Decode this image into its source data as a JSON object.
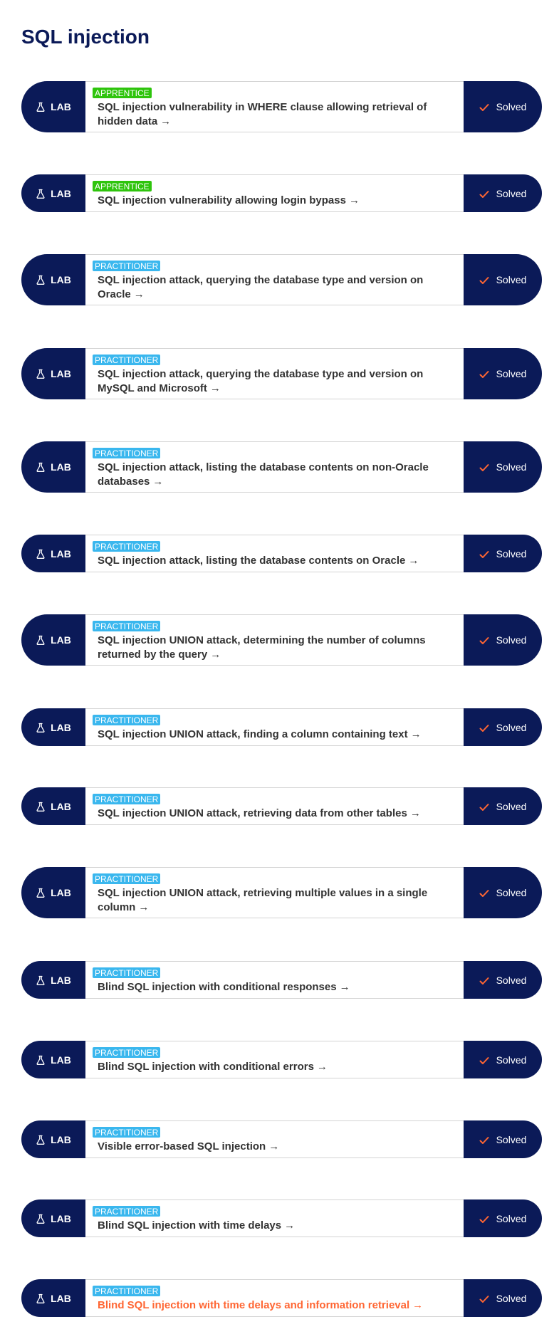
{
  "page": {
    "title": "SQL injection"
  },
  "colors": {
    "navy": "#0b1a58",
    "apprentice": "#2ec40c",
    "practitioner": "#3ab7ee",
    "accent_orange": "#ff6633",
    "text": "#333333"
  },
  "labs": [
    {
      "tag": "LAB",
      "level": "APPRENTICE",
      "title": "SQL injection vulnerability in WHERE clause allowing retrieval of hidden data",
      "status": "Solved",
      "arrow": "arrow-right-icon",
      "highlight": false
    },
    {
      "tag": "LAB",
      "level": "APPRENTICE",
      "title": "SQL injection vulnerability allowing login bypass",
      "status": "Solved",
      "arrow": "arrow-right-icon",
      "highlight": false
    },
    {
      "tag": "LAB",
      "level": "PRACTITIONER",
      "title": "SQL injection attack, querying the database type and version on Oracle",
      "status": "Solved",
      "arrow": "arrow-right-icon",
      "highlight": false
    },
    {
      "tag": "LAB",
      "level": "PRACTITIONER",
      "title": "SQL injection attack, querying the database type and version on MySQL and Microsoft",
      "status": "Solved",
      "arrow": "arrow-right-icon",
      "highlight": false
    },
    {
      "tag": "LAB",
      "level": "PRACTITIONER",
      "title": "SQL injection attack, listing the database contents on non-Oracle databases",
      "status": "Solved",
      "arrow": "arrow-right-icon",
      "highlight": false
    },
    {
      "tag": "LAB",
      "level": "PRACTITIONER",
      "title": "SQL injection attack, listing the database contents on Oracle",
      "status": "Solved",
      "arrow": "arrow-right-icon",
      "highlight": false
    },
    {
      "tag": "LAB",
      "level": "PRACTITIONER",
      "title": "SQL injection UNION attack, determining the number of columns returned by the query",
      "status": "Solved",
      "arrow": "arrow-right-icon",
      "highlight": false
    },
    {
      "tag": "LAB",
      "level": "PRACTITIONER",
      "title": "SQL injection UNION attack, finding a column containing text",
      "status": "Solved",
      "arrow": "arrow-right-icon",
      "highlight": false
    },
    {
      "tag": "LAB",
      "level": "PRACTITIONER",
      "title": "SQL injection UNION attack, retrieving data from other tables",
      "status": "Solved",
      "arrow": "arrow-right-icon",
      "highlight": false
    },
    {
      "tag": "LAB",
      "level": "PRACTITIONER",
      "title": "SQL injection UNION attack, retrieving multiple values in a single column",
      "status": "Solved",
      "arrow": "arrow-right-icon",
      "highlight": false
    },
    {
      "tag": "LAB",
      "level": "PRACTITIONER",
      "title": "Blind SQL injection with conditional responses",
      "status": "Solved",
      "arrow": "arrow-right-icon",
      "highlight": false
    },
    {
      "tag": "LAB",
      "level": "PRACTITIONER",
      "title": "Blind SQL injection with conditional errors",
      "status": "Solved",
      "arrow": "arrow-right-icon",
      "highlight": false
    },
    {
      "tag": "LAB",
      "level": "PRACTITIONER",
      "title": "Visible error-based SQL injection",
      "status": "Solved",
      "arrow": "arrow-right-icon",
      "highlight": false
    },
    {
      "tag": "LAB",
      "level": "PRACTITIONER",
      "title": "Blind SQL injection with time delays",
      "status": "Solved",
      "arrow": "arrow-right-icon",
      "highlight": false
    },
    {
      "tag": "LAB",
      "level": "PRACTITIONER",
      "title": "Blind SQL injection with time delays and information retrieval",
      "status": "Solved",
      "arrow": "arrow-right-icon",
      "highlight": true
    }
  ]
}
